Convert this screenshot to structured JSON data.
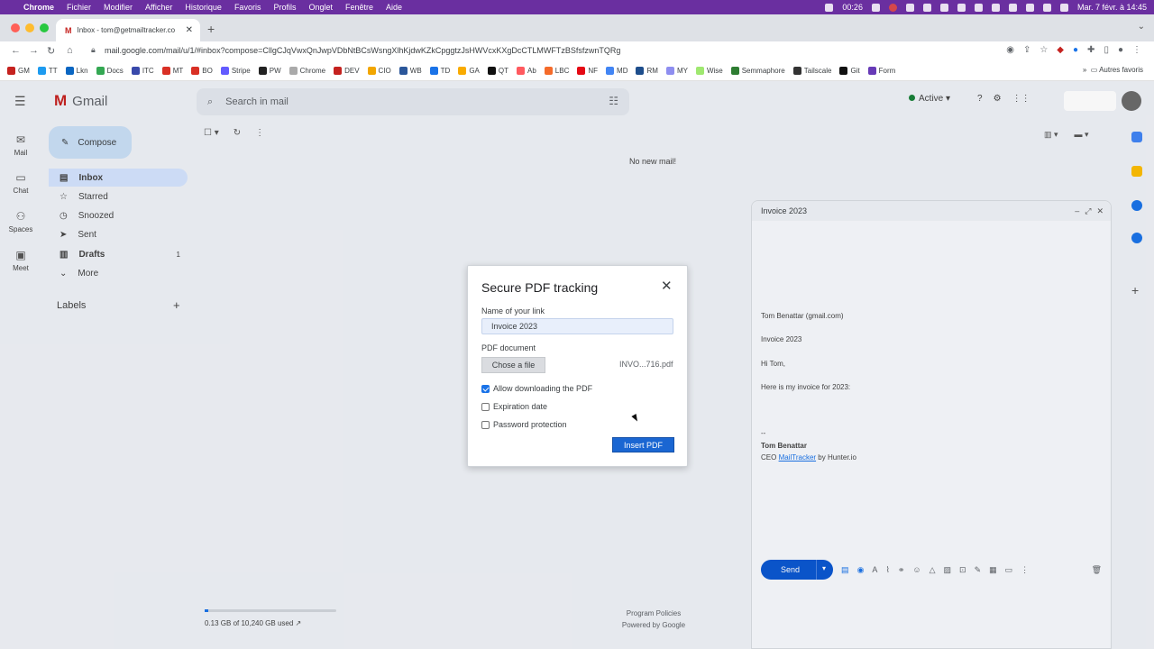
{
  "macbar": {
    "app": "Chrome",
    "menus": [
      "Fichier",
      "Modifier",
      "Afficher",
      "Historique",
      "Favoris",
      "Profils",
      "Onglet",
      "Fenêtre",
      "Aide"
    ],
    "clock": "00:26",
    "datetime": "Mar. 7 févr. à 14:45"
  },
  "browser": {
    "tab_title": "Inbox - tom@getmailtracker.co",
    "url": "mail.google.com/mail/u/1/#inbox?compose=CllgCJqVwxQnJwpVDbNtBCsWsngXlhKjdwKZkCpggtzJsHWVcxKXgDcCTLMWFTzBSfsfzwnTQRg",
    "bookmarks": [
      "GM",
      "TT",
      "Lkn",
      "Docs",
      "ITC",
      "MT",
      "BO",
      "Stripe",
      "PW",
      "Chrome",
      "DEV",
      "CIO",
      "WB",
      "TD",
      "GA",
      "QT",
      "Ab",
      "LBC",
      "NF",
      "MD",
      "RM",
      "MY",
      "Wise",
      "Semmaphore",
      "Tailscale",
      "Git",
      "Form"
    ],
    "bookmarks_more": "Autres favoris"
  },
  "gmail": {
    "logo": "Gmail",
    "search_placeholder": "Search in mail",
    "compose_label": "Compose",
    "rail": [
      "Mail",
      "Chat",
      "Spaces",
      "Meet"
    ],
    "nav": [
      {
        "label": "Inbox",
        "count": ""
      },
      {
        "label": "Starred",
        "count": ""
      },
      {
        "label": "Snoozed",
        "count": ""
      },
      {
        "label": "Sent",
        "count": ""
      },
      {
        "label": "Drafts",
        "count": "1"
      },
      {
        "label": "More",
        "count": ""
      }
    ],
    "labels_heading": "Labels",
    "status": "Active",
    "empty_message": "No new mail!",
    "storage": "0.13 GB of 10,240 GB used",
    "storage_fraction": 0.03,
    "footer_links": [
      "Program Policies",
      "Powered by Google"
    ]
  },
  "compose_window": {
    "title": "Invoice 2023",
    "to": "Tom Benattar (gmail.com)",
    "subject": "Invoice 2023",
    "greeting": "Hi Tom,",
    "body": "Here is my invoice for 2023:",
    "sig_sep": "--",
    "sig_name": "Tom Benattar",
    "sig_ceo": "CEO",
    "sig_link": "MailTracker",
    "sig_by": "by Hunter.io",
    "send_label": "Send"
  },
  "modal": {
    "title": "Secure PDF tracking",
    "link_label": "Name of your link",
    "link_value": "Invoice 2023",
    "pdf_label": "PDF document",
    "choose_label": "Chose a file",
    "file_name": "INVO...716.pdf",
    "opt_download": "Allow downloading the PDF",
    "opt_download_checked": true,
    "opt_expiration": "Expiration date",
    "opt_expiration_checked": false,
    "opt_password": "Password protection",
    "opt_password_checked": false,
    "insert_label": "Insert PDF"
  },
  "colors": {
    "accent": "#1a73e8",
    "macbar": "#6a2fa0",
    "insert": "#1a66d2"
  }
}
